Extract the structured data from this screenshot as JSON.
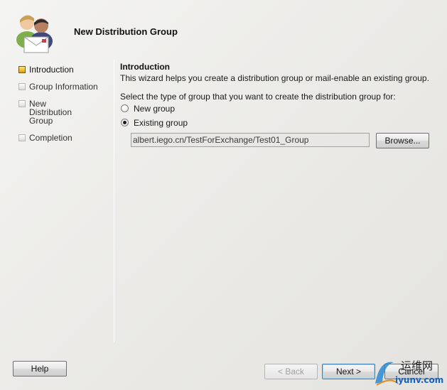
{
  "wizard": {
    "title": "New Distribution Group",
    "icon": "distribution-group-icon"
  },
  "steps": [
    {
      "label": "Introduction",
      "active": true
    },
    {
      "label": "Group Information",
      "active": false
    },
    {
      "label": "New Distribution Group",
      "active": false
    },
    {
      "label": "Completion",
      "active": false
    }
  ],
  "content": {
    "section_title": "Introduction",
    "description": "This wizard helps you create a distribution group or mail-enable an existing group.",
    "prompt": "Select the type of group that you want to create the distribution group for:",
    "options": [
      {
        "label": "New group",
        "checked": false
      },
      {
        "label": "Existing group",
        "checked": true
      }
    ],
    "group_path": "albert.iego.cn/TestForExchange/Test01_Group",
    "browse_label": "Browse..."
  },
  "buttons": {
    "help": "Help",
    "back": "< Back",
    "next": "Next >",
    "cancel": "Cancel"
  },
  "watermark": {
    "text": "运维网",
    "url": "iyunv.com"
  },
  "colors": {
    "active_step": "#e0a400",
    "focus_border": "#3c7fb1",
    "watermark_url": "#1660c0"
  }
}
